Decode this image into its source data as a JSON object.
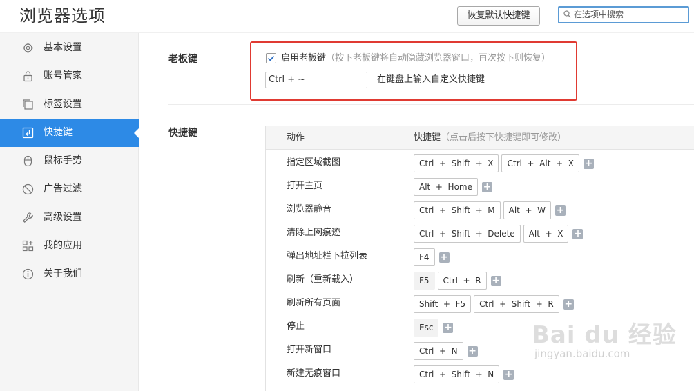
{
  "header": {
    "title": "浏览器选项",
    "restore_button": "恢复默认快捷键",
    "search_placeholder": "在选项中搜索"
  },
  "sidebar": {
    "items": [
      {
        "label": "基本设置",
        "icon": "gear-icon",
        "active": false
      },
      {
        "label": "账号管家",
        "icon": "lock-icon",
        "active": false
      },
      {
        "label": "标签设置",
        "icon": "tabs-icon",
        "active": false
      },
      {
        "label": "快捷键",
        "icon": "keyboard-icon",
        "active": true
      },
      {
        "label": "鼠标手势",
        "icon": "mouse-icon",
        "active": false
      },
      {
        "label": "广告过滤",
        "icon": "block-icon",
        "active": false
      },
      {
        "label": "高级设置",
        "icon": "wrench-icon",
        "active": false
      },
      {
        "label": "我的应用",
        "icon": "apps-icon",
        "active": false
      },
      {
        "label": "关于我们",
        "icon": "info-icon",
        "active": false
      }
    ]
  },
  "boss_key": {
    "section_label": "老板键",
    "checkbox_checked": true,
    "enable_label": "启用老板键",
    "enable_hint": "（按下老板键将自动隐藏浏览器窗口，再次按下则恢复）",
    "input_value": "Ctrl + ~",
    "input_hint": "在键盘上输入自定义快捷键"
  },
  "shortcuts": {
    "section_label": "快捷键",
    "col_action": "动作",
    "col_key": "快捷键",
    "col_key_hint": "（点击后按下快捷键即可修改）",
    "rows": [
      {
        "action": "指定区域截图",
        "keys": [
          {
            "text": "Ctrl  +  Shift  +  X",
            "plain": false
          },
          {
            "text": "Ctrl  +  Alt  +  X",
            "plain": false
          }
        ]
      },
      {
        "action": "打开主页",
        "keys": [
          {
            "text": "Alt  +  Home",
            "plain": false
          }
        ]
      },
      {
        "action": "浏览器静音",
        "keys": [
          {
            "text": "Ctrl  +  Shift  +  M",
            "plain": false
          },
          {
            "text": "Alt  +  W",
            "plain": false
          }
        ]
      },
      {
        "action": "清除上网痕迹",
        "keys": [
          {
            "text": "Ctrl  +  Shift  +  Delete",
            "plain": false
          },
          {
            "text": "Alt  +  X",
            "plain": false
          }
        ]
      },
      {
        "action": "弹出地址栏下拉列表",
        "keys": [
          {
            "text": "F4",
            "plain": false
          }
        ]
      },
      {
        "action": "刷新（重新载入）",
        "keys": [
          {
            "text": "F5",
            "plain": true
          },
          {
            "text": "Ctrl  +  R",
            "plain": false
          }
        ]
      },
      {
        "action": "刷新所有页面",
        "keys": [
          {
            "text": "Shift  +  F5",
            "plain": false
          },
          {
            "text": "Ctrl  +  Shift  +  R",
            "plain": false
          }
        ]
      },
      {
        "action": "停止",
        "keys": [
          {
            "text": "Esc",
            "plain": true
          }
        ]
      },
      {
        "action": "打开新窗口",
        "keys": [
          {
            "text": "Ctrl  +  N",
            "plain": false
          }
        ]
      },
      {
        "action": "新建无痕窗口",
        "keys": [
          {
            "text": "Ctrl  +  Shift  +  N",
            "plain": false
          }
        ]
      }
    ],
    "add_symbol": "+"
  },
  "watermark": {
    "text": "Bai du 经验",
    "url": "jingyan.baidu.com"
  },
  "colors": {
    "accent": "#2d8ae6",
    "highlight": "#e03a32"
  }
}
